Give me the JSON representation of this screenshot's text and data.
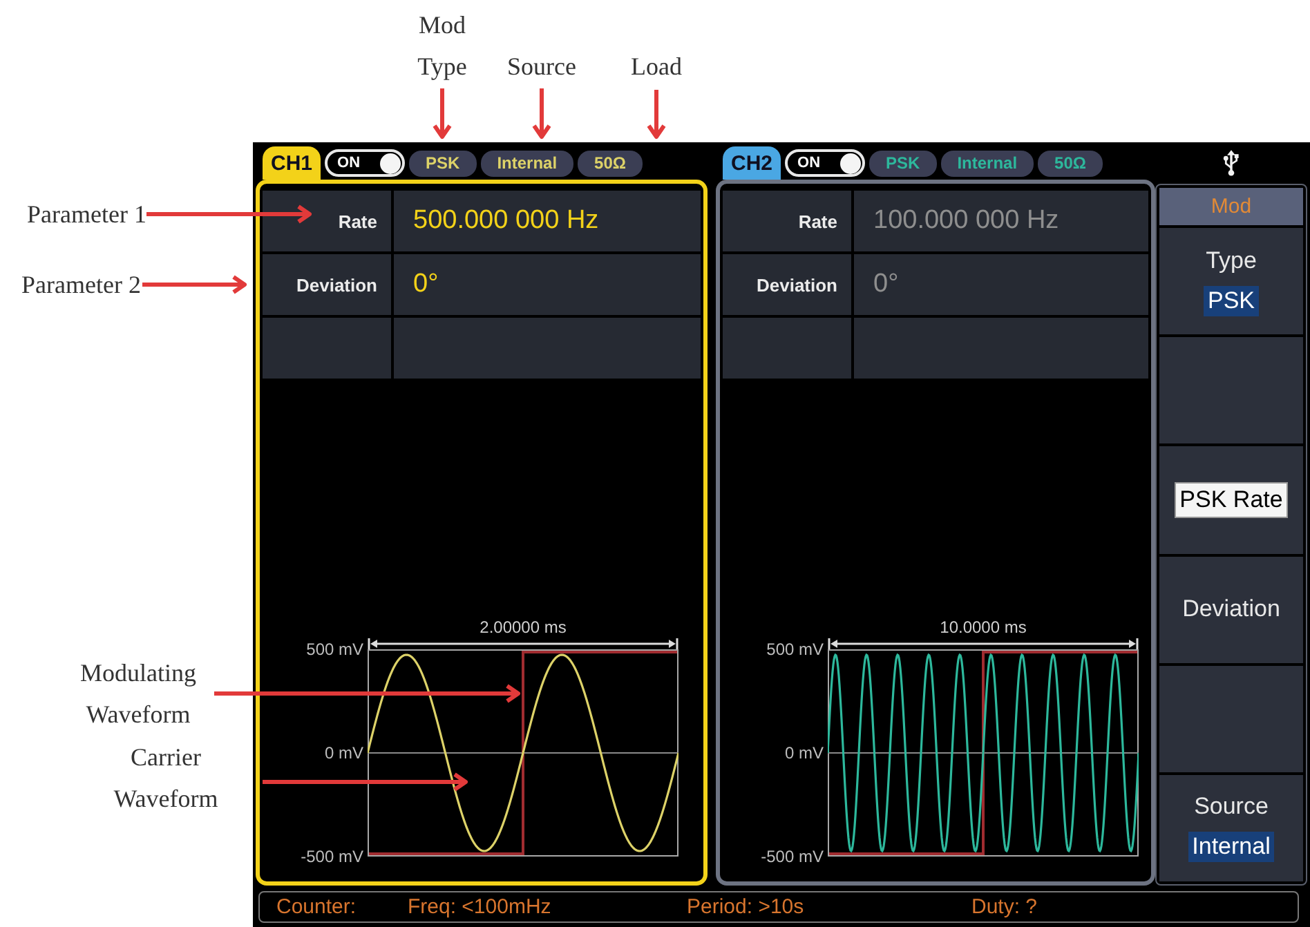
{
  "top_callouts": [
    {
      "text": "Mod Type"
    },
    {
      "text": "Source"
    },
    {
      "text": "Load"
    }
  ],
  "side_callouts": [
    {
      "text": "Parameter 1"
    },
    {
      "text": "Parameter 2"
    },
    {
      "text": "Modulating Waveform"
    },
    {
      "text": "Carrier Waveform"
    }
  ],
  "channels": [
    {
      "tab": {
        "label": "CH1",
        "color": "#f3d219"
      },
      "selected": true,
      "output": {
        "label": "ON",
        "on": true
      },
      "settings": [
        "PSK",
        "Internal",
        "50Ω"
      ],
      "params": [
        {
          "label": "Rate",
          "value": "500.000 000 Hz"
        },
        {
          "label": "Deviation",
          "value": "0°"
        }
      ],
      "waveform": {
        "color": "#ddd268",
        "span": "2.00000 ms",
        "y_labels": [
          "500 mV",
          "0 mV",
          "-500 mV"
        ]
      }
    },
    {
      "tab": {
        "label": "CH2",
        "color": "#4aa7e3"
      },
      "selected": false,
      "output": {
        "label": "ON",
        "on": true
      },
      "settings": [
        "PSK",
        "Internal",
        "50Ω"
      ],
      "params": [
        {
          "label": "Rate",
          "value": "100.000 000 Hz"
        },
        {
          "label": "Deviation",
          "value": "0°"
        }
      ],
      "waveform": {
        "color": "#2db89c",
        "span": "10.0000 ms",
        "y_labels": [
          "500 mV",
          "0 mV",
          "-500 mV"
        ]
      }
    }
  ],
  "softkeys": {
    "title": "Mod",
    "items": [
      {
        "kind": "option",
        "label": "Type",
        "value": "PSK",
        "selected": false
      },
      {
        "kind": "blank",
        "selected": false
      },
      {
        "kind": "button",
        "label": "PSK Rate",
        "selected": true
      },
      {
        "kind": "button",
        "label": "Deviation",
        "selected": false
      },
      {
        "kind": "blank",
        "selected": false
      },
      {
        "kind": "option",
        "label": "Source",
        "value": "Internal",
        "selected": false
      }
    ]
  },
  "status_bar": {
    "label": "Counter:",
    "readings": [
      "Freq: <100mHz",
      "Period: >10s",
      "Duty: ?"
    ]
  }
}
